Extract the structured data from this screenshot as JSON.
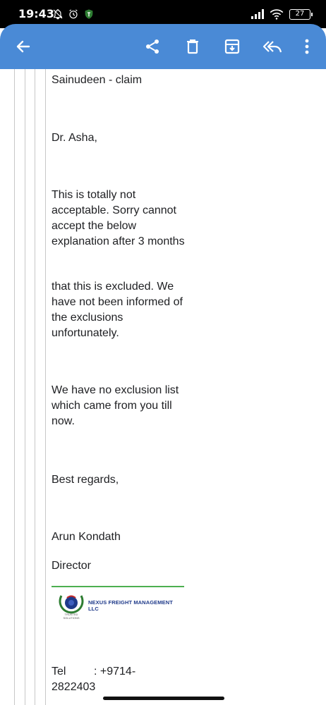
{
  "status_bar": {
    "time": "19:43",
    "battery": "27"
  },
  "app_bar": {
    "accent_color": "#4a8ad6",
    "icons": [
      "back-arrow-icon",
      "share-icon",
      "delete-icon",
      "archive-icon",
      "reply-icon",
      "more-vert-icon"
    ]
  },
  "email": {
    "subject_tail": "Sainudeen - claim",
    "greeting": "Dr. Asha,",
    "para1": "This is totally not acceptable. Sorry cannot accept the below explanation after 3 months",
    "para2": "that this is excluded. We have not been informed of the exclusions unfortunately.",
    "para3": "We have no exclusion list which came from you till now.",
    "closing": "Best regards,",
    "sender_name": "Arun Kondath",
    "sender_title": "Director",
    "logo_text": "NEXUS FREIGHT MANAGEMENT LLC",
    "logo_subtext": "TRUSTED SOLUTIONS",
    "tel_label": "Tel",
    "tel_value": ": +9714-",
    "tel_value_2": "2822403"
  }
}
